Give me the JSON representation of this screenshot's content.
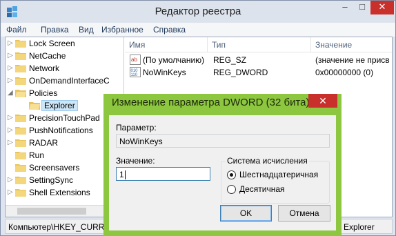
{
  "window": {
    "title": "Редактор реестра",
    "controls": {
      "minimize": "–",
      "maximize": "□",
      "close": "✕"
    }
  },
  "menu": [
    "Файл",
    "Правка",
    "Вид",
    "Избранное",
    "Справка"
  ],
  "tree": {
    "items": [
      {
        "label": "Lock Screen",
        "expander": "▷",
        "selected": false
      },
      {
        "label": "NetCache",
        "expander": "▷",
        "selected": false
      },
      {
        "label": "Network",
        "expander": "▷",
        "selected": false
      },
      {
        "label": "OnDemandInterfaceC",
        "expander": "▷",
        "selected": false
      },
      {
        "label": "Policies",
        "expander": "◢",
        "selected": false
      },
      {
        "label": "Explorer",
        "expander": "",
        "selected": true
      },
      {
        "label": "PrecisionTouchPad",
        "expander": "▷",
        "selected": false
      },
      {
        "label": "PushNotifications",
        "expander": "▷",
        "selected": false
      },
      {
        "label": "RADAR",
        "expander": "▷",
        "selected": false
      },
      {
        "label": "Run",
        "expander": "",
        "selected": false
      },
      {
        "label": "Screensavers",
        "expander": "",
        "selected": false
      },
      {
        "label": "SettingSync",
        "expander": "▷",
        "selected": false
      },
      {
        "label": "Shell Extensions",
        "expander": "▷",
        "selected": false
      }
    ]
  },
  "list": {
    "columns": [
      "Имя",
      "Тип",
      "Значение"
    ],
    "rows": [
      {
        "icon": "string-value-icon",
        "name": "(По умолчанию)",
        "type": "REG_SZ",
        "value": "(значение не присв"
      },
      {
        "icon": "binary-value-icon",
        "name": "NoWinKeys",
        "type": "REG_DWORD",
        "value": "0x00000000 (0)"
      }
    ]
  },
  "status": {
    "path": "Компьютер\\HKEY_CURREI",
    "path_tail": "Explorer"
  },
  "dialog": {
    "title": "Изменение параметра DWORD (32 бита)",
    "close": "✕",
    "param_label": "Параметр:",
    "param_value": "NoWinKeys",
    "value_label": "Значение:",
    "value_input": "1",
    "radix_group_label": "Система исчисления",
    "radix_options": [
      {
        "label": "Шестнадцатеричная",
        "checked": true
      },
      {
        "label": "Десятичная",
        "checked": false
      }
    ],
    "ok_label": "OK",
    "cancel_label": "Отмена"
  }
}
